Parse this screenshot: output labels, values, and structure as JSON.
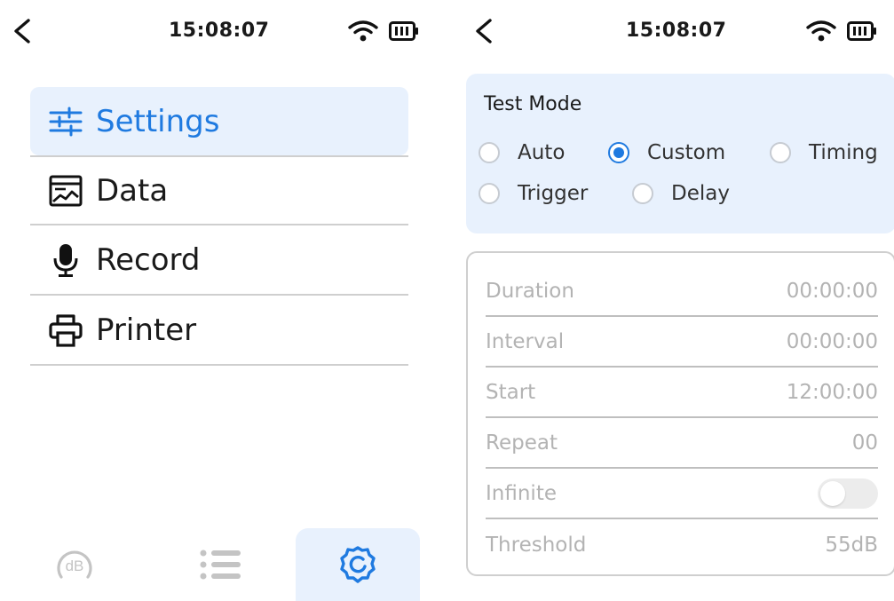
{
  "left_screen": {
    "status_bar": {
      "time": "15:08:07",
      "back_icon": "chevron-left-icon",
      "wifi_icon": "wifi-icon",
      "battery_icon": "battery-icon"
    },
    "menu": [
      {
        "label": "Settings",
        "icon": "sliders-icon",
        "active": true
      },
      {
        "label": "Data",
        "icon": "chart-image-icon",
        "active": false
      },
      {
        "label": "Record",
        "icon": "microphone-icon",
        "active": false
      },
      {
        "label": "Printer",
        "icon": "printer-icon",
        "active": false
      }
    ],
    "bottom_nav": [
      {
        "label": "dB",
        "icon": "db-meter-icon",
        "active": false
      },
      {
        "icon": "list-icon",
        "active": false
      },
      {
        "icon": "gear-icon",
        "active": true
      }
    ]
  },
  "right_screen": {
    "status_bar": {
      "time": "15:08:07",
      "back_icon": "chevron-left-icon",
      "wifi_icon": "wifi-icon",
      "battery_icon": "battery-icon"
    },
    "test_mode": {
      "title": "Test Mode",
      "options": [
        {
          "label": "Auto",
          "checked": false
        },
        {
          "label": "Custom",
          "checked": true
        },
        {
          "label": "Timing",
          "checked": false
        },
        {
          "label": "Trigger",
          "checked": false
        },
        {
          "label": "Delay",
          "checked": false
        }
      ]
    },
    "params": [
      {
        "label": "Duration",
        "value": "00:00:00"
      },
      {
        "label": "Interval",
        "value": "00:00:00"
      },
      {
        "label": "Start",
        "value": "12:00:00"
      },
      {
        "label": "Repeat",
        "value": "00"
      },
      {
        "label": "Infinite",
        "toggle": false
      },
      {
        "label": "Threshold",
        "value": "55dB"
      }
    ]
  },
  "colors": {
    "accent": "#1f7ae0",
    "active_bg": "#e8f1fd",
    "disabled_text": "#b3b3b3",
    "divider": "#cfcfcf"
  }
}
